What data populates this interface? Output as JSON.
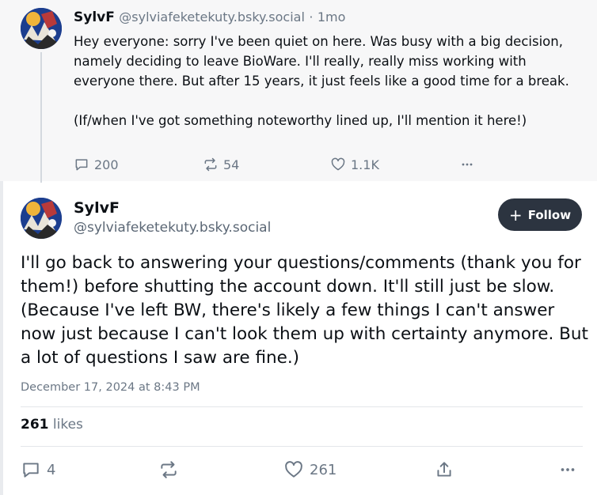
{
  "parent_post": {
    "display_name": "SylvF",
    "handle": "@sylviafeketekuty.bsky.social",
    "separator": "·",
    "time_ago": "1mo",
    "text_paragraphs": [
      "Hey everyone: sorry I've been quiet on here. Was busy with a big decision, namely deciding to leave BioWare. I'll really, really miss working with everyone there. But after 15 years, it just feels like a good time for a break.",
      "(If/when I've got something noteworthy lined up, I'll mention it here!)"
    ],
    "actions": {
      "reply_count": "200",
      "repost_count": "54",
      "like_count": "1.1K",
      "more_icon": "ellipsis-icon"
    }
  },
  "main_post": {
    "display_name": "SylvF",
    "handle": "@sylviafeketekuty.bsky.social",
    "follow_label": "Follow",
    "text": "I'll go back to answering your questions/comments (thank you for them!) before shutting the account down. It'll still just be slow. (Because I've left BW, there's likely a few things I can't answer now just because I can't look them up with certainty anymore. But a lot of questions I saw are fine.)",
    "timestamp": "December 17, 2024 at 8:43 PM",
    "likes_count": "261",
    "likes_label": "likes",
    "actions": {
      "reply_count": "4",
      "like_count": "261"
    }
  },
  "colors": {
    "text_primary": "#0b0f14",
    "text_secondary": "#6b7785",
    "follow_button_bg": "#2c3440",
    "parent_bg": "#f7f7f8"
  },
  "icons": [
    "reply-icon",
    "repost-icon",
    "heart-icon",
    "share-icon",
    "ellipsis-icon",
    "plus-icon"
  ]
}
